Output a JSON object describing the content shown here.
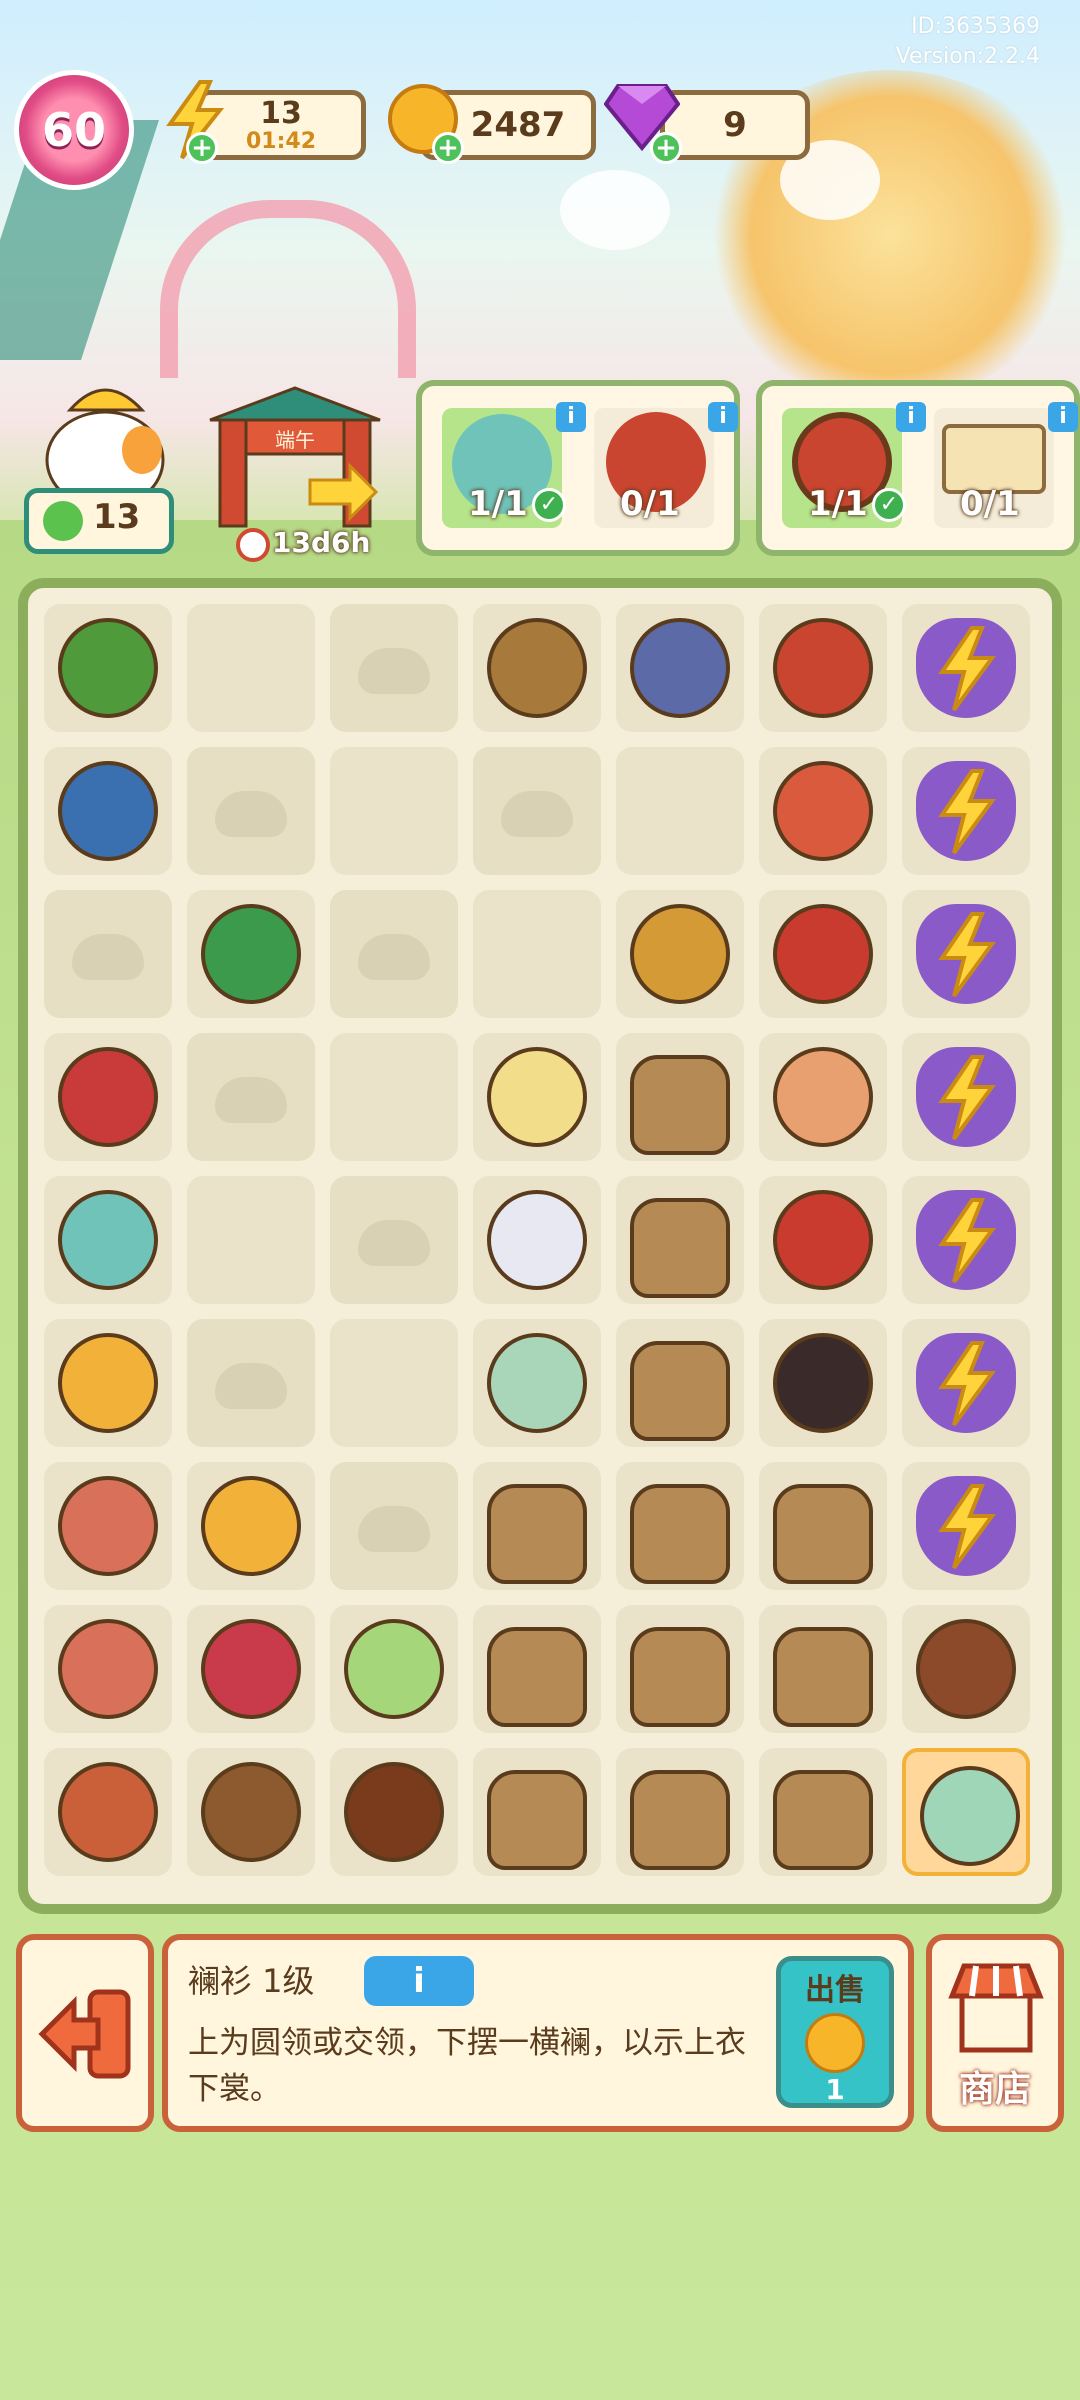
{
  "header": {
    "id_text": "ID:3635369",
    "version": "Version:2.2.4",
    "level": "60",
    "energy": {
      "value": "13",
      "timer": "01:42"
    },
    "coins": {
      "value": "2487"
    },
    "gems": {
      "value": "9"
    }
  },
  "hero": {
    "leaf_count": "13"
  },
  "event": {
    "timer": "13d6h",
    "sign": "端午"
  },
  "orders": [
    {
      "items": [
        {
          "icon": "dragon-toy",
          "count": "1/1",
          "done": true
        },
        {
          "icon": "lion-bell",
          "count": "0/1",
          "done": false
        }
      ]
    },
    {
      "items": [
        {
          "icon": "drum-pot",
          "count": "1/1",
          "done": true
        },
        {
          "icon": "scroll",
          "count": "0/1",
          "done": false
        }
      ]
    }
  ],
  "board": {
    "cells": [
      [
        "zongzi-leaves",
        "empty",
        "fog",
        "basket",
        "machine",
        "drum-pot",
        "bolt-kite"
      ],
      [
        "brush",
        "fog",
        "empty",
        "fog",
        "empty",
        "drum",
        "bolt-kite"
      ],
      [
        "fog",
        "pump",
        "fog",
        "empty",
        "paddle",
        "red-drum",
        "bolt-kite"
      ],
      [
        "gift-box",
        "fog",
        "empty",
        "butter",
        "rice-bag",
        "tambourine",
        "bolt-kite"
      ],
      [
        "dragon-toy",
        "empty",
        "fog",
        "jar",
        "rice-bag",
        "rattle",
        "bolt-kite"
      ],
      [
        "egg",
        "fog",
        "empty",
        "hanfu-green",
        "rice-bag",
        "hanfu-black",
        "bolt-kite"
      ],
      [
        "ham",
        "egg",
        "fog",
        "rice-bag",
        "rice-bag",
        "rice-bag",
        "bolt-kite"
      ],
      [
        "ham",
        "gourd",
        "zongzi",
        "rice-bag",
        "rice-bag",
        "rice-bag",
        "stall"
      ],
      [
        "bacon",
        "log",
        "chestnut",
        "rice-bag",
        "rice-bag",
        "rice-bag",
        "lanshan"
      ]
    ]
  },
  "selected": {
    "title": "襕衫 1级",
    "info_label": "i",
    "description": "上为圆领或交领，下摆一横襕，以示上衣下裳。",
    "sell_label": "出售",
    "sell_value": "1"
  },
  "shop_label": "商店",
  "colors": {
    "board_border": "#8cad5c",
    "panel_border": "#c9623a",
    "sell_bg": "#36c3c8",
    "info_blue": "#3aa6e8"
  }
}
